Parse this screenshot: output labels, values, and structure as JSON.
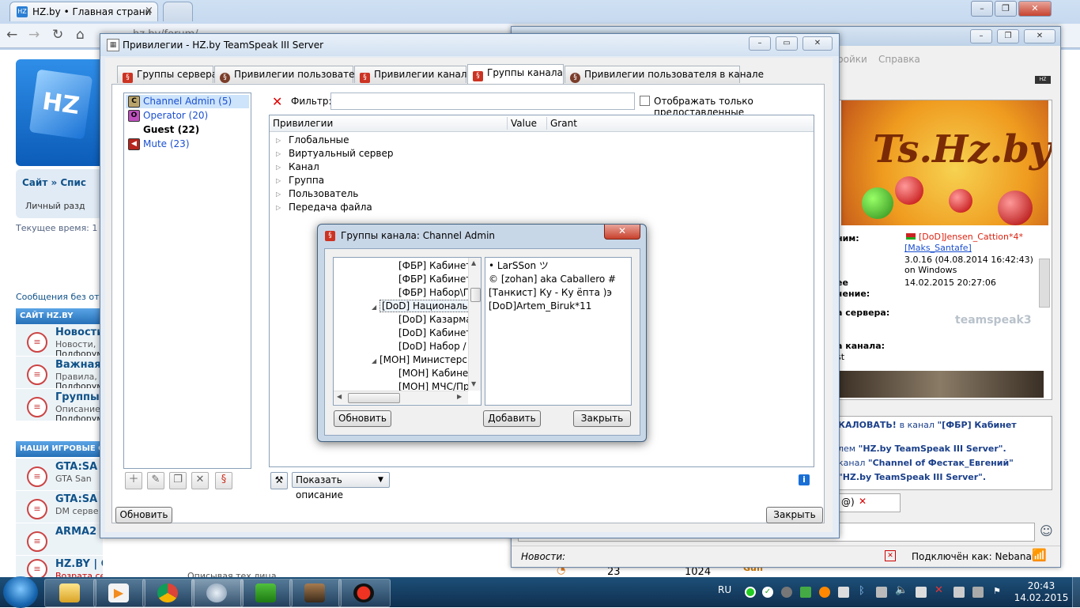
{
  "browser": {
    "tab_title": "HZ.by • Главная страниц",
    "tab_favicon": "hz",
    "address": "hz.by/forum/",
    "colors": {
      "frame": "#bcd1ea",
      "tab": "#f6f8fb"
    }
  },
  "forum": {
    "breadcrumb": "Сайт » Спис",
    "personal": "Личный разд",
    "time_label": "Текущее время: 1",
    "messages_label": "Сообщения без от",
    "section_site": "САЙТ HZ.BY",
    "site_forums": [
      {
        "title": "Новости",
        "desc": "Новости,",
        "sub": "Подфорум"
      },
      {
        "title": "Важная и",
        "desc": "Правила,",
        "sub": "Подфорум"
      },
      {
        "title": "Группы",
        "desc": "Описание",
        "sub": "Подфорум"
      }
    ],
    "section_games": "НАШИ ИГРОВЫЕ СЕ",
    "game_forums": [
      {
        "title": "GTA:SA",
        "desc": "GTA San"
      },
      {
        "title": "GTA:SA S",
        "desc": "DM серве"
      },
      {
        "title": "ARMA2 D",
        "desc": ""
      }
    ],
    "cs_title": "HZ.BY | CS 1.6",
    "cs_sub": "Возрата сервера CS 1.6",
    "cs_sub2": "Описывая тех лица",
    "stats": [
      "23",
      "1024"
    ],
    "last_user": "Guff"
  },
  "ts_main": {
    "menu": [
      "ройки",
      "Справка"
    ],
    "info_labels": [
      "ним:",
      "ее",
      "чение:",
      "а сервера:",
      "а канала:",
      "st"
    ],
    "nick": "[DoD]Jensen_Cattion*4*",
    "nick2": "[Maks_Santafe]",
    "version": "3.0.16 (04.08.2014 16:42:43)",
    "os": "on Windows",
    "date": "14.02.2015 20:27:06",
    "banner": "Ts.Hz.by",
    "ts_logo": "teamspeak3",
    "chat": [
      {
        "pre": "КАЛОВАТЬ! ",
        "mid": " в канал ",
        "chan": "\"[ФБР] Кабинет"
      },
      {
        "pre": "лем ",
        "chan": "\"HZ.by TeamSpeak III Server\"."
      },
      {
        "pre": "канал ",
        "chan": "\"Channel of Фестак_Евгений\""
      },
      {
        "pre": "",
        "chan": "\"HZ.by TeamSpeak III Server\"."
      }
    ],
    "news_label": "Новости:",
    "connected": "Подключён как: Nebanano"
  },
  "priv": {
    "window_title": "Привилегии - HZ.by TeamSpeak III Server",
    "tabs": [
      {
        "label": "Группы сервера",
        "icon": "§"
      },
      {
        "label": "Привилегии пользователя",
        "icon": "user"
      },
      {
        "label": "Привилегии канала",
        "icon": "§"
      },
      {
        "label": "Группы канала",
        "icon": "§"
      },
      {
        "label": "Привилегии пользователя в канале",
        "icon": "user"
      }
    ],
    "groups": [
      {
        "label": "Channel Admin (5)",
        "letter": "C",
        "color": "#1a4fd0",
        "icon_bg": "#b8a36a"
      },
      {
        "label": "Operator (20)",
        "letter": "O",
        "color": "#1a4fd0",
        "icon_bg": "#c04fbf"
      },
      {
        "label": "Guest (22)",
        "letter": "",
        "color": "#000000",
        "icon_bg": ""
      },
      {
        "label": "Mute (23)",
        "letter": "◀",
        "color": "#1a4fd0",
        "icon_bg": "#b8241c"
      }
    ],
    "filter_label": "Фильтр:",
    "filter_value": "",
    "only_granted_label": "Отображать только предоставленные",
    "only_granted_checked": false,
    "columns": [
      "Привилегии",
      "Value",
      "Grant"
    ],
    "perm_nodes": [
      "Глобальные",
      "Виртуальный сервер",
      "Канал",
      "Группа",
      "Пользователь",
      "Передача файла"
    ],
    "desc_select": "Показать описание",
    "refresh": "Обновить",
    "close": "Закрыть"
  },
  "cg_dialog": {
    "title": "Группы канала: Channel Admin",
    "tree": [
      {
        "label": "[ФБР] Кабинет Д",
        "indent": 3,
        "expander": ""
      },
      {
        "label": "[ФБР] Кабинет З",
        "indent": 3,
        "expander": ""
      },
      {
        "label": "[ФБР] Набор\\П",
        "indent": 3,
        "expander": ""
      },
      {
        "label": "[DoD] Национальн",
        "indent": 2,
        "expander": "◢",
        "selected": true
      },
      {
        "label": "[DoD] Казарма",
        "indent": 3,
        "expander": ""
      },
      {
        "label": "[DoD] Кабинет Е",
        "indent": 3,
        "expander": ""
      },
      {
        "label": "[DoD] Набор / Г",
        "indent": 3,
        "expander": ""
      },
      {
        "label": "[МОН] Министерс",
        "indent": 2,
        "expander": "◢"
      },
      {
        "label": "[МОН] Кабинет",
        "indent": 3,
        "expander": ""
      },
      {
        "label": "[МОН] МЧС/Пр",
        "indent": 3,
        "expander": ""
      }
    ],
    "members": [
      "• LarSSon ツ",
      "© [zohan] aka Caballero #",
      "[Танкист] Ку - Ку ёпта )э",
      "[DoD]Artem_Biruk*11"
    ],
    "refresh": "Обновить",
    "add": "Добавить",
    "close": "Закрыть"
  },
  "taskbar": {
    "lang": "RU",
    "time": "20:43",
    "date": "14.02.2015"
  }
}
